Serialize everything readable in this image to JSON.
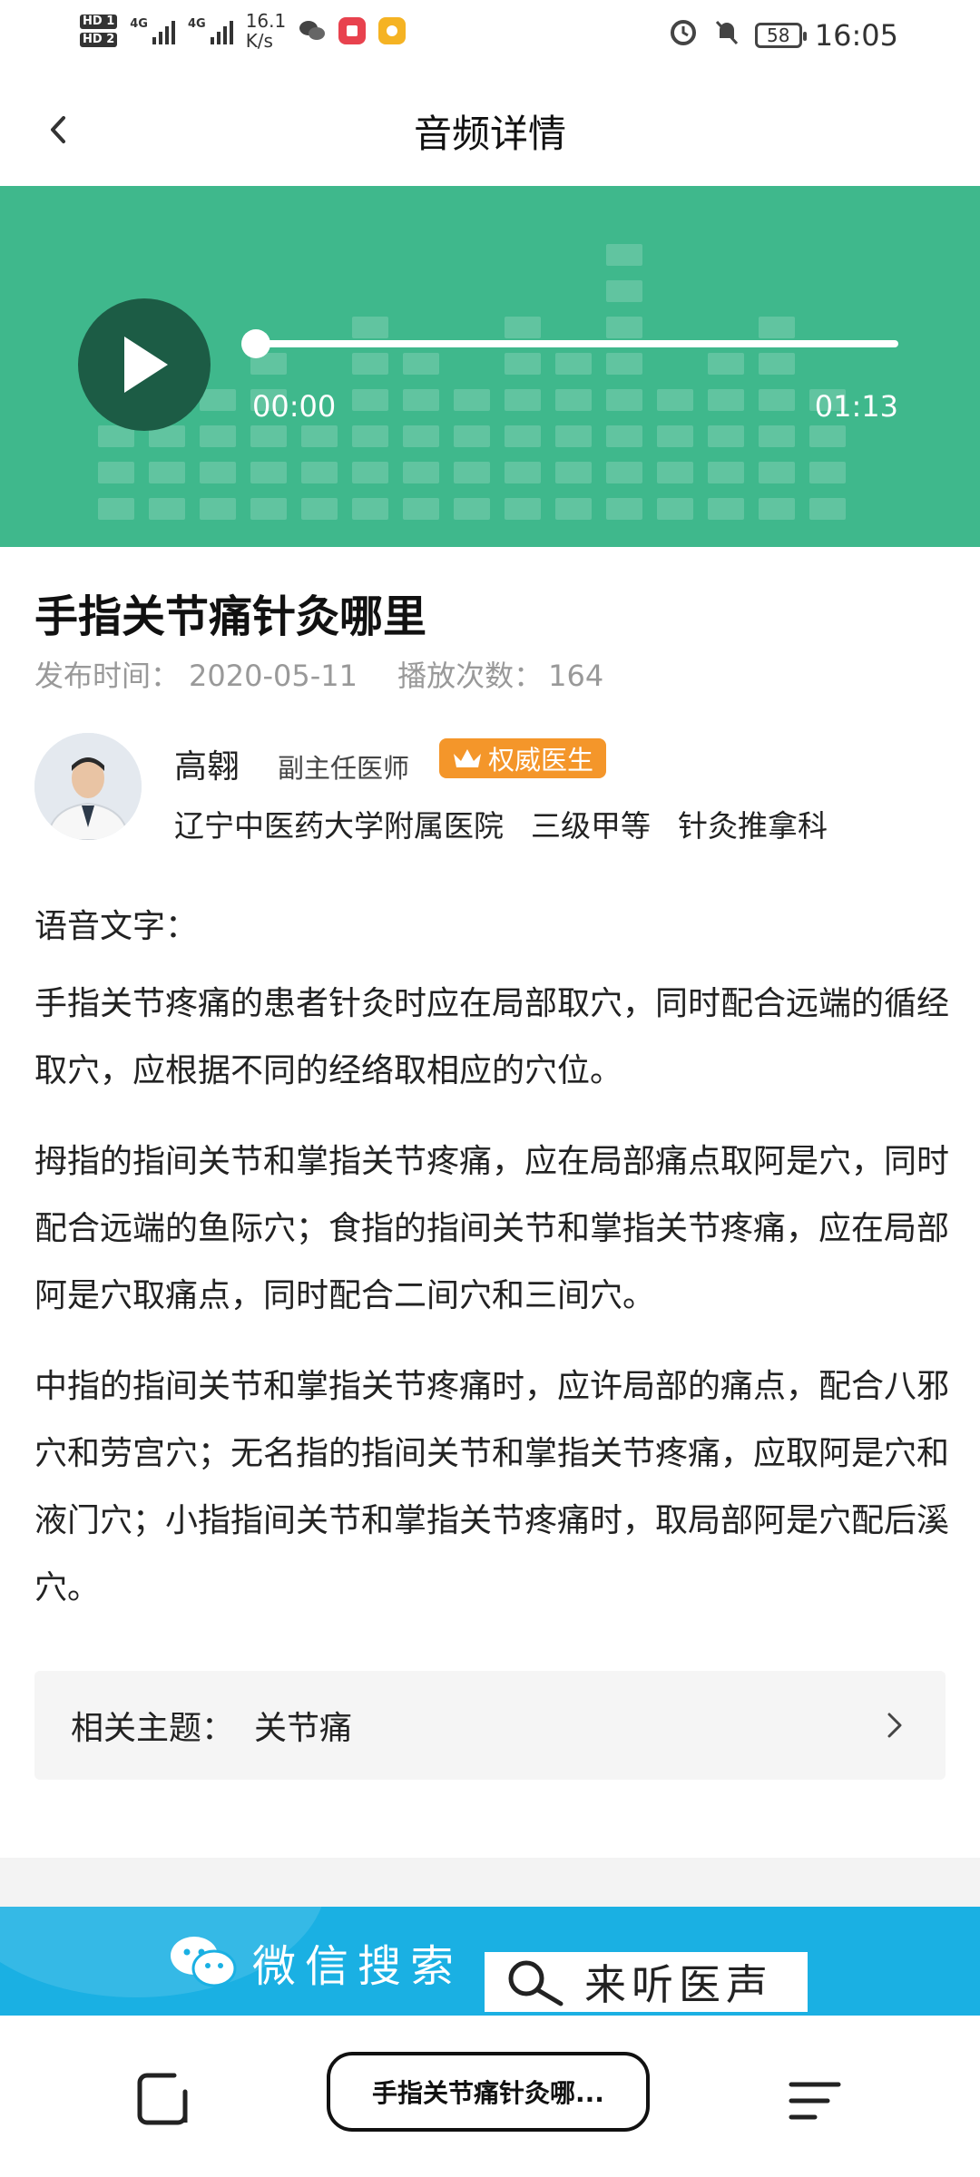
{
  "status_bar": {
    "hd1": "HD 1",
    "hd2": "HD 2",
    "net1": "4G",
    "net2": "4G",
    "speed_value": "16.1",
    "speed_unit": "K/s",
    "battery": "58",
    "time": "16:05",
    "icons": [
      "wechat-icon",
      "red-app-icon",
      "yellow-app-icon",
      "alarm-icon",
      "mute-bell-icon"
    ]
  },
  "nav": {
    "title": "音频详情",
    "back_icon": "chevron-left-icon"
  },
  "player": {
    "current_time": "00:00",
    "total_time": "01:13",
    "progress": 0,
    "accent_color": "#3fb88c",
    "button_color": "#1c5c45",
    "play_icon": "play-icon"
  },
  "article": {
    "title": "手指关节痛针灸哪里",
    "publish_label": "发布时间：",
    "publish_date": "2020-05-11",
    "plays_label": "播放次数：",
    "plays_count": "164"
  },
  "doctor": {
    "name": "高翱",
    "rank": "副主任医师",
    "badge": "权威医生",
    "badge_color": "#f4962a",
    "hospital": "辽宁中医药大学附属医院",
    "level": "三级甲等",
    "department": "针灸推拿科"
  },
  "content": {
    "label": "语音文字：",
    "paragraphs": [
      "手指关节疼痛的患者针灸时应在局部取穴，同时配合远端的循经取穴，应根据不同的经络取相应的穴位。",
      "拇指的指间关节和掌指关节疼痛，应在局部痛点取阿是穴，同时配合远端的鱼际穴；食指的指间关节和掌指关节疼痛，应在局部阿是穴取痛点，同时配合二间穴和三间穴。",
      "中指的指间关节和掌指关节疼痛时，应许局部的痛点，配合八邪穴和劳宫穴；无名指的指间关节和掌指关节疼痛，应取阿是穴和液门穴；小指指间关节和掌指关节疼痛时，取局部阿是穴配后溪穴。"
    ]
  },
  "topic": {
    "label": "相关主题：",
    "value": "关节痛"
  },
  "banner": {
    "text": "微信搜索",
    "search_text": "来听医声",
    "color": "#1ab0e3"
  },
  "bottom_bar": {
    "pill_text": "手指关节痛针灸哪..."
  }
}
